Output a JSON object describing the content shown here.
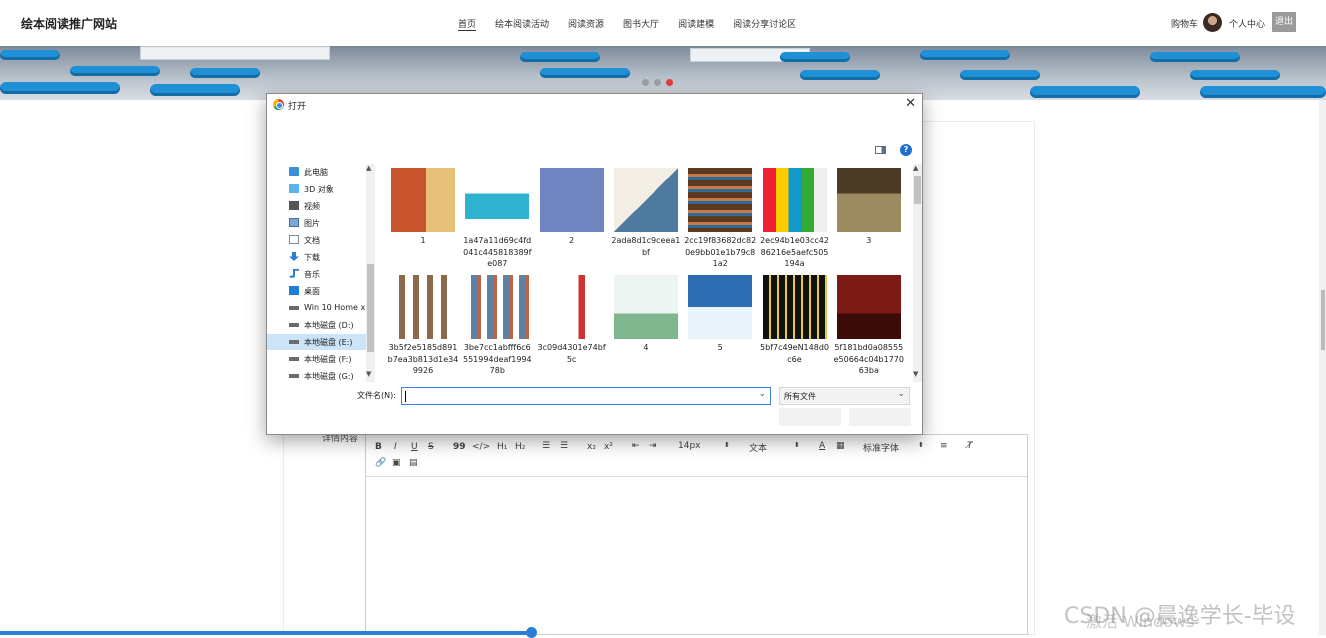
{
  "site": {
    "title": "绘本阅读推广网站"
  },
  "nav": {
    "items": [
      "首页",
      "绘本阅读活动",
      "阅读资源",
      "图书大厅",
      "阅读建模",
      "阅读分享讨论区"
    ],
    "cart": "购物车",
    "user_center": "个人中心",
    "logout": "退出"
  },
  "banner": {
    "slides": 3,
    "active_slide": 3
  },
  "form": {
    "detail_label": "详情内容"
  },
  "editor": {
    "toolbar": {
      "bold": "B",
      "italic": "I",
      "underline": "U",
      "strike": "S",
      "quote": "99",
      "code": "</>",
      "h1": "H₁",
      "h2": "H₂",
      "sub": "x₂",
      "sup": "x²",
      "font_size": "14px",
      "paragraph": "文本",
      "font_family": "标准字体"
    }
  },
  "dialog": {
    "title": "打开",
    "tree": [
      {
        "label": "此电脑",
        "icon": "computer-icon"
      },
      {
        "label": "3D 对象",
        "icon": "cube-icon"
      },
      {
        "label": "视频",
        "icon": "video-icon"
      },
      {
        "label": "图片",
        "icon": "picture-icon"
      },
      {
        "label": "文档",
        "icon": "document-icon"
      },
      {
        "label": "下载",
        "icon": "download-icon"
      },
      {
        "label": "音乐",
        "icon": "music-icon"
      },
      {
        "label": "桌面",
        "icon": "desktop-icon"
      },
      {
        "label": "Win 10 Home x",
        "icon": "drive-icon"
      },
      {
        "label": "本地磁盘 (D:)",
        "icon": "drive-icon"
      },
      {
        "label": "本地磁盘 (E:)",
        "icon": "drive-icon",
        "selected": true
      },
      {
        "label": "本地磁盘 (F:)",
        "icon": "drive-icon"
      },
      {
        "label": "本地磁盘 (G:)",
        "icon": "drive-icon"
      }
    ],
    "files": [
      {
        "name": "1"
      },
      {
        "name": "1a47a11d69c4fd041c445818389fe087"
      },
      {
        "name": "2"
      },
      {
        "name": "2ada8d1c9ceea1bf"
      },
      {
        "name": "2cc19f83682dc820e9bb01e1b79c81a2"
      },
      {
        "name": "2ec94b1e03cc4286216e5aefc505194a"
      },
      {
        "name": "3"
      },
      {
        "name": "3b5f2e5185d891b7ea3b813d1e349926"
      },
      {
        "name": "3be7cc1abfff6c6551994deaf199478b"
      },
      {
        "name": "3c09d4301e74bf5c"
      },
      {
        "name": "4"
      },
      {
        "name": "5"
      },
      {
        "name": "5bf7c49eN148d0c6e"
      },
      {
        "name": "5f181bd0a08555e50664c04b177063ba"
      }
    ],
    "filename_label": "文件名(N):",
    "filename_value": "",
    "filter_value": "所有文件",
    "open_label": "",
    "cancel_label": ""
  },
  "watermark": {
    "text": "CSDN @晨逸学长-毕设",
    "activate": "激活 Windows"
  },
  "colors": {
    "accent": "#2a7fd4",
    "banner_seat": "#1f8fd6",
    "active_dot": "#e83b3b",
    "selection": "#cce4f7"
  }
}
